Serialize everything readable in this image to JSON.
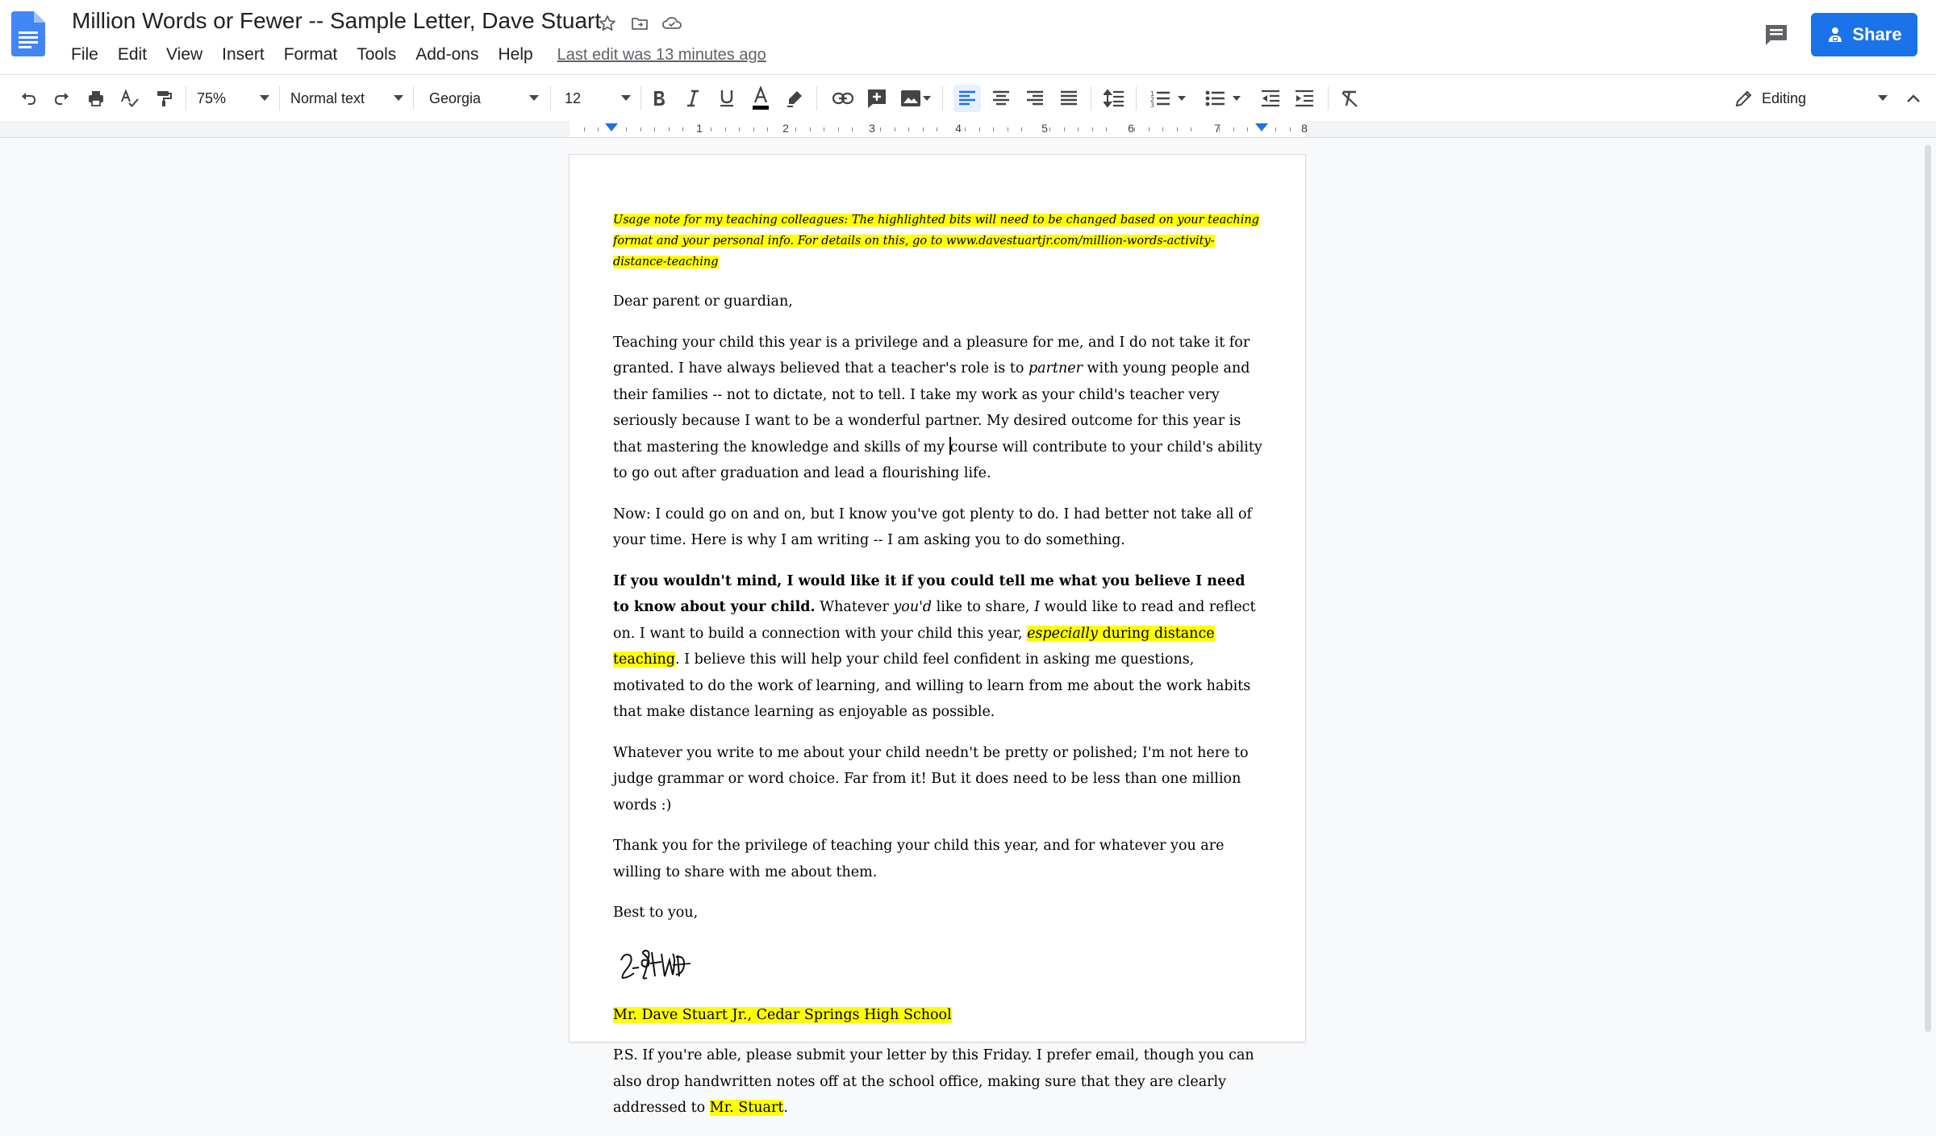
{
  "header": {
    "title": "Million Words or Fewer -- Sample Letter, Dave Stuart",
    "menu": [
      "File",
      "Edit",
      "View",
      "Insert",
      "Format",
      "Tools",
      "Add-ons",
      "Help"
    ],
    "last_edit": "Last edit was 13 minutes ago",
    "share_label": "Share"
  },
  "toolbar": {
    "zoom": "75%",
    "style": "Normal text",
    "font": "Georgia",
    "font_size": "12",
    "mode": "Editing"
  },
  "ruler": {
    "numbers": [
      "1",
      "2",
      "3",
      "4",
      "5",
      "6",
      "7",
      "8"
    ]
  },
  "document": {
    "usage_note": "Usage note for my teaching colleagues: The highlighted bits will need to be changed based on your teaching format and your personal info. For details on this, go to www.davestuartjr.com/million-words-activity-distance-teaching",
    "greeting": "Dear parent or guardian,",
    "p1_a": "Teaching your child this year is a privilege and a pleasure for me, and I do not take it for granted. I have always believed that a teacher's role is to ",
    "p1_em": "partner",
    "p1_b": " with young people and their families -- not to dictate, not to tell. I take my work as your child's teacher very seriously because I want to be a wonderful partner. My desired outcome for this year is that mastering the knowledge and skills of my ",
    "p1_c": "course will contribute to your child's ability to go out after graduation and lead a flourishing life.",
    "p2": "Now: I could go on and on, but I know you've got plenty to do. I had better not take all of your time. Here is why I am writing -- I am asking you to do something.",
    "p3_bold": "If you wouldn't mind, I would like it if you could tell me what you believe I need to know about your child.",
    "p3_a": " Whatever ",
    "p3_em1": "you'd",
    "p3_b": " like to share, ",
    "p3_em2": "I",
    "p3_c": " would like to read and reflect on. I want to build a connection with your child this year, ",
    "p3_hl_em": "especially",
    "p3_hl": " during distance teaching",
    "p3_d": ". I believe this will help your child feel confident in asking me questions, motivated to do the work of learning, and willing to learn from me about the work habits that make distance learning as enjoyable as possible.",
    "p4": "Whatever you write to me about your child needn't be pretty or polished; I'm not here to judge grammar or word choice. Far from it! But it does need to be less than one million words :)",
    "p5": "Thank you for the privilege of teaching your child this year, and for whatever you are willing to share with me about them.",
    "closing": "Best to you,",
    "signer": "Mr. Dave Stuart Jr., Cedar Springs High School",
    "ps_a": "P.S. If you're able, please submit your letter by this Friday. I prefer email, though you can also drop handwritten notes off at the school office, making sure that they are clearly addressed to ",
    "ps_hl": "Mr. Stuart",
    "ps_b": "."
  },
  "colors": {
    "accent": "#1a73e8",
    "highlight": "#ffff00",
    "docs_blue": "#4285f4"
  }
}
